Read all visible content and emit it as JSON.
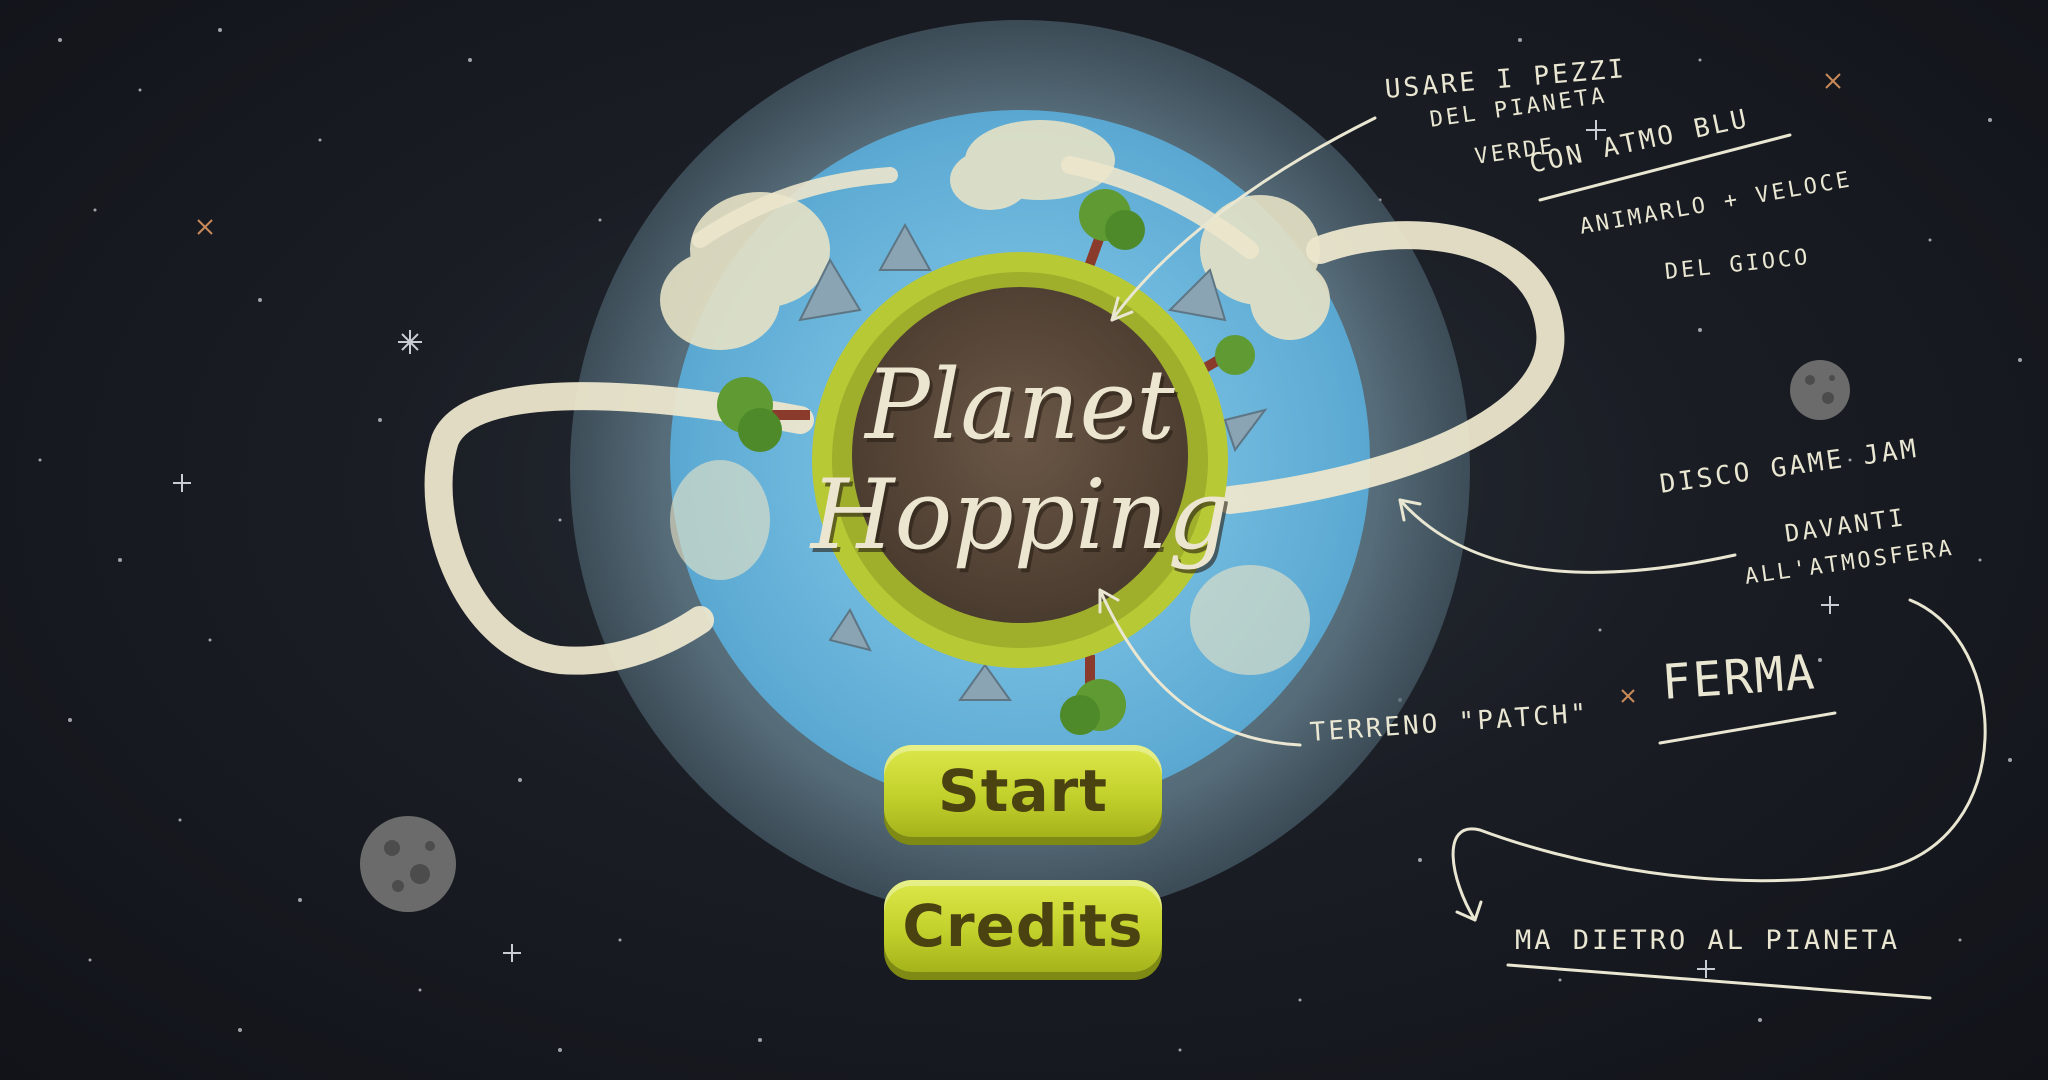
{
  "game": {
    "title_line1": "Planet",
    "title_line2": "Hopping",
    "buttons": {
      "start": "Start",
      "credits": "Credits"
    }
  },
  "notes": {
    "n1": "USARE I PEZZI",
    "n2": "DEL PIANETA",
    "n3": "VERDE",
    "n4": "CON ATMO BLU",
    "n5": "ANIMARLO + VELOCE",
    "n6": "DEL GIOCO",
    "n7": "DISCO GAME JAM",
    "n8": "DAVANTI",
    "n9": "ALL'ATMOSFERA",
    "n10": "TERRENO \"PATCH\"",
    "n11": "FERMA",
    "n12": "MA DIETRO AL PIANETA"
  },
  "colors": {
    "background": "#16181e",
    "atmosphere_outer": "#5f7886",
    "atmosphere_inner": "#6ab3d8",
    "planet_core": "#5a4a3c",
    "grass": "#b7c934",
    "button": "#c8d52f",
    "button_text": "#4a4210",
    "annotation_ink": "#e9e6d2"
  }
}
